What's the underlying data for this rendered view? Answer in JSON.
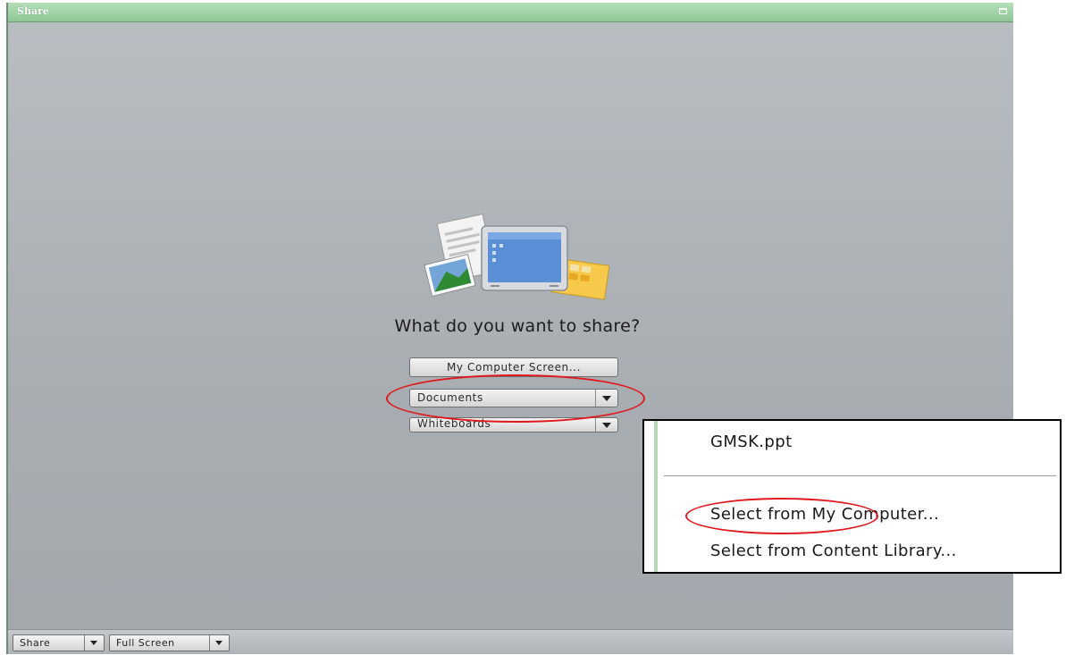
{
  "window": {
    "title": "Share"
  },
  "main": {
    "prompt": "What do you want to share?",
    "buttons": {
      "screen": "My Computer Screen...",
      "documents": "Documents",
      "whiteboards": "Whiteboards"
    }
  },
  "bottom_bar": {
    "share_label": "Share",
    "fullscreen_label": "Full Screen"
  },
  "documents_menu": {
    "items": [
      "GMSK.ppt",
      "Select from My Computer...",
      "Select from Content Library..."
    ]
  },
  "annotations": {
    "highlight_color": "#e0191e"
  },
  "colors": {
    "titlebar": "#9fd3a5",
    "background": "#aeb3b8",
    "menu_gutter": "#b6d8b8"
  }
}
